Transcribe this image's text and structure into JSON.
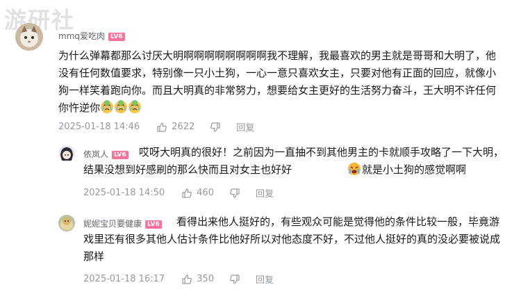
{
  "watermark": "游研社",
  "comments": [
    {
      "username": "mmq爱吃肉",
      "level": "LV6",
      "text": "为什么弹幕都那么讨厌大明啊啊啊啊啊啊啊啊我不理解，我最喜欢的男主就是哥哥和大明了，他没有任何数值要求，特别像一只小土狗，一心一意只喜欢女主，只要对他有正面的回应，就像小狗一样笑着跑向你。而且大明真的非常努力，想要给女主更好的生活努力奋斗，王大明不许任何你忤逆你",
      "time": "2025-01-18 14:46",
      "likes": "2622",
      "reply_label": "回复"
    },
    {
      "username": "依岚人",
      "level": "LV6",
      "text_before_emoji": "哎呀大明真的很好！之前因为一直抽不到其他男主的卡就顺手攻略了一下大明，结果没想到好感刷的那么快而且对女主也好好",
      "text_after_emoji": "就是小土狗的感觉啊啊",
      "time": "2025-01-18 14:50",
      "likes": "460",
      "reply_label": "回复"
    },
    {
      "username": "妮妮宝贝要健康",
      "level": "LV6",
      "text": "看得出来他人挺好的，有些观众可能是觉得他的条件比较一般，毕竟游戏里还有很多其他人估计条件比他好所以对他态度不好，不过他人挺好的真的没必要被说成那样",
      "time": "2025-01-18 16:17",
      "likes": "350",
      "reply_label": "回复"
    }
  ]
}
